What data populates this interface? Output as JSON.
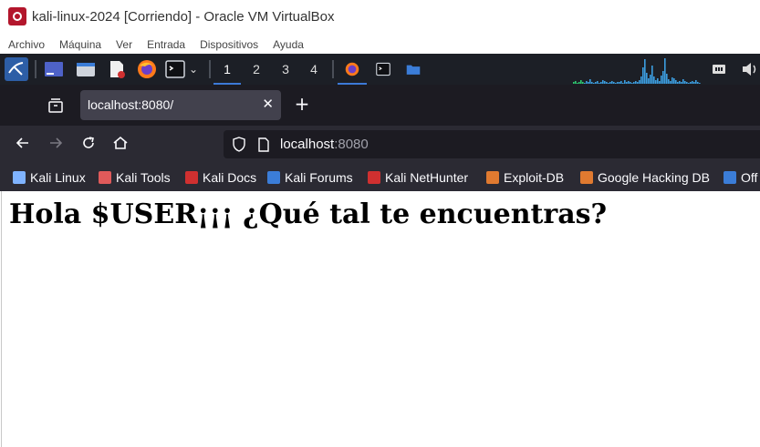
{
  "window": {
    "title": "kali-linux-2024 [Corriendo] - Oracle VM VirtualBox",
    "menu": [
      "Archivo",
      "Máquina",
      "Ver",
      "Entrada",
      "Dispositivos",
      "Ayuda"
    ]
  },
  "panel": {
    "workspaces": [
      "1",
      "2",
      "3",
      "4"
    ],
    "active_workspace": "1",
    "launchers": [
      "show-desktop-icon",
      "file-manager-icon",
      "text-editor-icon",
      "firefox-icon",
      "terminal-icon"
    ],
    "tasks": [
      "firefox-icon",
      "terminal-icon",
      "folder-icon"
    ],
    "tray": [
      "network-icon",
      "volume-icon"
    ]
  },
  "browser": {
    "tab_title": "localhost:8080/",
    "new_tab_label": "+",
    "url_host": "localhost",
    "url_port": ":8080",
    "bookmarks": [
      {
        "label": "Kali Linux",
        "color": "#7fb3ff"
      },
      {
        "label": "Kali Tools",
        "color": "#e05a5a"
      },
      {
        "label": "Kali Docs",
        "color": "#d03030"
      },
      {
        "label": "Kali Forums",
        "color": "#3b7dd8"
      },
      {
        "label": "Kali NetHunter",
        "color": "#d03030"
      },
      {
        "label": "Exploit-DB",
        "color": "#e07a30"
      },
      {
        "label": "Google Hacking DB",
        "color": "#e07a30"
      },
      {
        "label": "Off",
        "color": "#3b7dd8"
      }
    ]
  },
  "page": {
    "heading": "Hola $USER¡¡¡ ¿Qué tal te encuentras?"
  },
  "colors": {
    "panel_bg": "#1c1f26",
    "accent": "#3c7ad8",
    "browser_chrome": "#2b2a33",
    "tab_strip": "#1c1b22"
  }
}
